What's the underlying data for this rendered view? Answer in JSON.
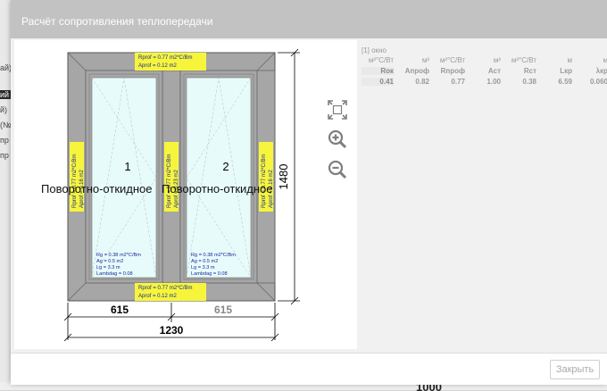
{
  "dialog": {
    "title": "Расчёт сопротивления теплопередачи",
    "close_label": "Закрыть"
  },
  "background": {
    "left_fragments": [
      "ай)",
      "ий",
      "й)",
      "(№",
      "пр",
      "пр"
    ],
    "bottom_fragment": "1000"
  },
  "drawing": {
    "sash1": {
      "number": "1",
      "type": "Поворотно-откидное"
    },
    "sash2": {
      "number": "2",
      "type": "Поворотно-откидное"
    },
    "frame_profile": {
      "r": "Rprof = 0.77  m2*C/Bm",
      "a": "Aprof = 0.12  m2"
    },
    "left_profile": {
      "r": "Rprof = 0.77  m2*C/Bm",
      "a": "Aprof = 0.16  m2"
    },
    "mullion_profile": {
      "r": "Rprof = 0.77  m2*C/Bm",
      "a": "Aprof = 0.23  m2"
    },
    "right_profile": {
      "r": "Rprof = 0.77  m2*C/Bm",
      "a": "Aprof = 0.16  m2"
    },
    "glass1": [
      "Rg = 0.38  m2*C/Bm",
      "Ag = 0.5  m2",
      "Lg = 3.3  m",
      "Lambdag = 0.08"
    ],
    "glass2": [
      "Rg = 0.38  m2*C/Bm",
      "Ag = 0.5  m2",
      "Lg = 3.3  m",
      "Lambdag = 0.08"
    ],
    "dimensions": {
      "left_width": "615",
      "right_width": "615",
      "total_width": "1230",
      "height": "1480"
    },
    "colors": {
      "frame": "#a6a6a6",
      "glass": "#e7fbfb",
      "label_bg": "#f6f53c",
      "glass_text": "#1a2a9a",
      "dimension": "#000000"
    }
  },
  "toolbar": {
    "icons": [
      "fit-to-screen-icon",
      "zoom-in-icon",
      "zoom-out-icon"
    ]
  },
  "results": {
    "section": "[1] окно",
    "units": [
      "м²°С/Вт",
      "м²",
      "м²°С/Вт",
      "м²",
      "м²°С/Вт",
      "м",
      "м"
    ],
    "headers": [
      "Rок",
      "Aпроф",
      "Rпроф",
      "Aст",
      "Rст",
      "Lкр",
      "λкр"
    ],
    "values": [
      "0.41",
      "0.82",
      "0.77",
      "1.00",
      "0.38",
      "6.59",
      "0.060"
    ]
  }
}
